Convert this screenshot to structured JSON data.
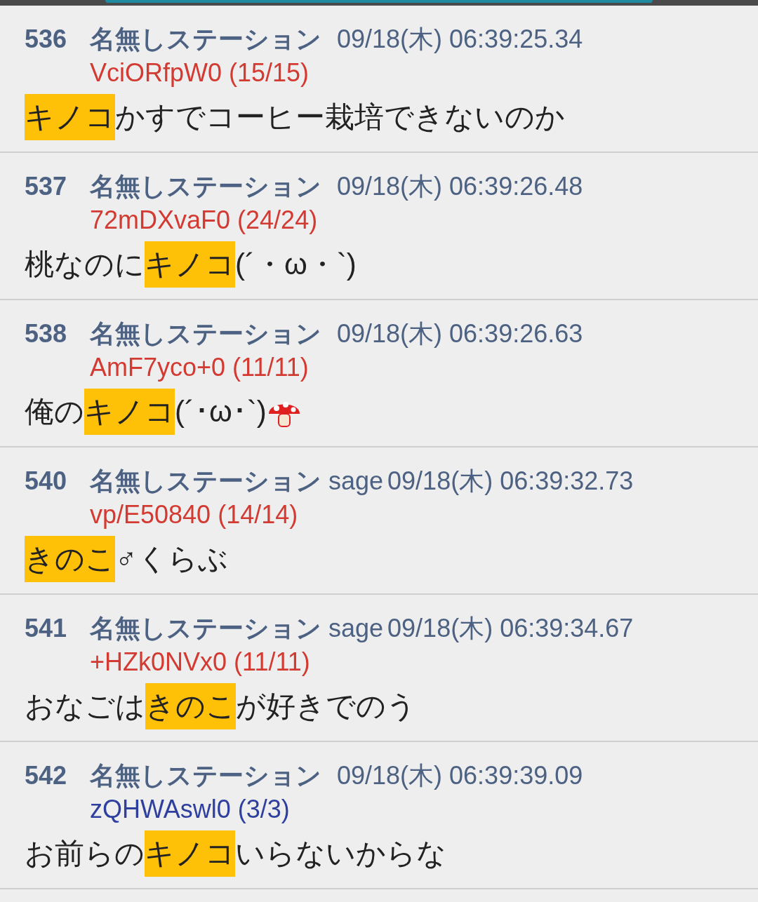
{
  "posts": [
    {
      "number": "536",
      "name": "名無しステーション",
      "date": "09/18(木) 06:39:25.34",
      "id": {
        "text": "VciORfpW0 (15/15)",
        "color": "#d23a32"
      },
      "body": [
        {
          "kind": "text",
          "text": "キノコ",
          "highlighted": true
        },
        {
          "kind": "text",
          "text": "かすでコーヒー栽培できないのか",
          "highlighted": false
        }
      ]
    },
    {
      "number": "537",
      "name": "名無しステーション",
      "date": "09/18(木) 06:39:26.48",
      "id": {
        "text": "72mDXvaF0 (24/24)",
        "color": "#d23a32"
      },
      "body": [
        {
          "kind": "text",
          "text": "桃なのに",
          "highlighted": false
        },
        {
          "kind": "text",
          "text": "キノコ",
          "highlighted": true
        },
        {
          "kind": "text",
          "text": "(´・ω・`)",
          "highlighted": false
        }
      ]
    },
    {
      "number": "538",
      "name": "名無しステーション",
      "date": "09/18(木) 06:39:26.63",
      "id": {
        "text": "AmF7yco+0 (11/11)",
        "color": "#d23a32"
      },
      "body": [
        {
          "kind": "text",
          "text": "俺の",
          "highlighted": false
        },
        {
          "kind": "text",
          "text": "キノコ",
          "highlighted": true
        },
        {
          "kind": "text",
          "text": "(´･ω･`)",
          "highlighted": false
        },
        {
          "kind": "icon"
        }
      ]
    },
    {
      "number": "540",
      "name": "名無しステーション",
      "mail": "sage",
      "date": "09/18(木) 06:39:32.73",
      "id": {
        "text": "vp/E50840 (14/14)",
        "color": "#d23a32"
      },
      "body": [
        {
          "kind": "text",
          "text": "きのこ",
          "highlighted": true
        },
        {
          "kind": "text",
          "text": "♂くらぶ",
          "highlighted": false
        }
      ]
    },
    {
      "number": "541",
      "name": "名無しステーション",
      "mail": "sage",
      "date": "09/18(木) 06:39:34.67",
      "id": {
        "text": "+HZk0NVx0 (11/11)",
        "color": "#d23a32"
      },
      "body": [
        {
          "kind": "text",
          "text": "おなごは",
          "highlighted": false
        },
        {
          "kind": "text",
          "text": "きのこ",
          "highlighted": true
        },
        {
          "kind": "text",
          "text": "が好きでのう",
          "highlighted": false
        }
      ]
    },
    {
      "number": "542",
      "name": "名無しステーション",
      "date": "09/18(木) 06:39:39.09",
      "id": {
        "text": "zQHWAswl0 (3/3)",
        "color": "#2f3f9e"
      },
      "body": [
        {
          "kind": "text",
          "text": "お前らの",
          "highlighted": false
        },
        {
          "kind": "text",
          "text": "キノコ",
          "highlighted": true
        },
        {
          "kind": "text",
          "text": "いらないからな",
          "highlighted": false
        }
      ]
    }
  ]
}
